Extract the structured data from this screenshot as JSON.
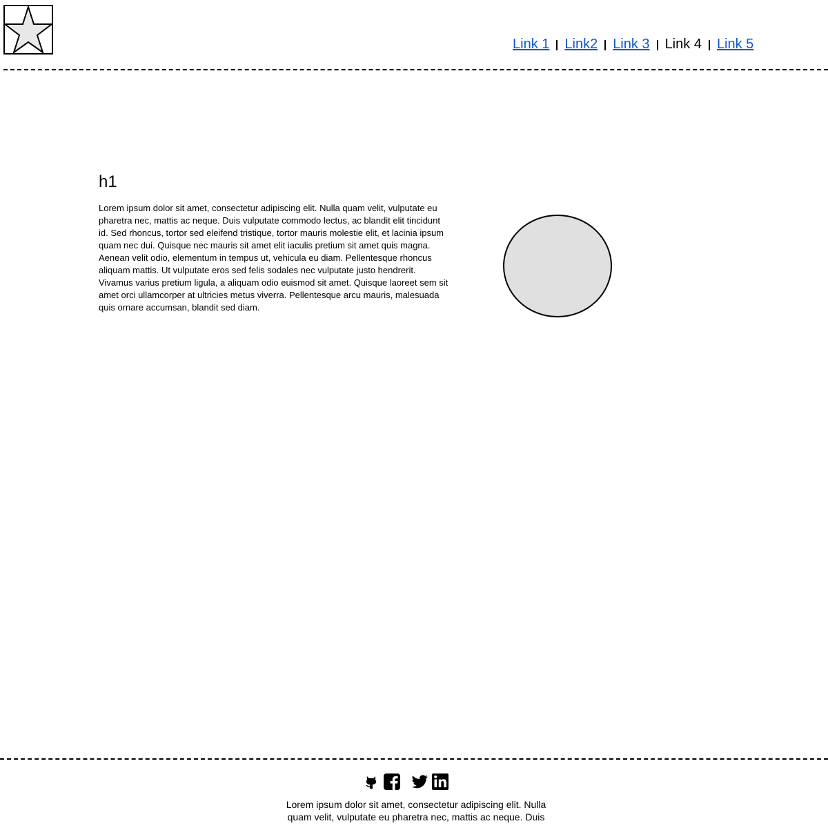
{
  "header": {
    "logo_icon": "star-icon",
    "nav": [
      {
        "label": "Link 1",
        "is_link": true
      },
      {
        "label": "Link2",
        "is_link": true
      },
      {
        "label": "Link 3",
        "is_link": true
      },
      {
        "label": "Link 4",
        "is_link": false
      },
      {
        "label": "Link 5",
        "is_link": true
      }
    ]
  },
  "main": {
    "title": "h1",
    "body": "Lorem ipsum dolor sit amet, consectetur adipiscing elit. Nulla quam velit, vulputate eu pharetra nec, mattis ac neque. Duis vulputate commodo lectus, ac blandit elit tincidunt id. Sed rhoncus, tortor sed eleifend tristique, tortor mauris molestie elit, et lacinia ipsum quam nec dui. Quisque nec mauris sit amet elit iaculis pretium sit amet quis magna. Aenean velit odio, elementum in tempus ut, vehicula eu diam. Pellentesque rhoncus aliquam mattis. Ut vulputate eros sed felis sodales nec vulputate justo hendrerit. Vivamus varius pretium ligula, a aliquam odio euismod sit amet. Quisque laoreet sem sit amet orci ullamcorper at ultricies metus viverra. Pellentesque arcu mauris, malesuada quis ornare accumsan, blandit sed diam.",
    "image_placeholder": "circle-image-placeholder"
  },
  "footer": {
    "social_icons": [
      "github-icon",
      "facebook-icon",
      "twitter-icon",
      "linkedin-icon"
    ],
    "text": "Lorem ipsum dolor sit amet, consectetur adipiscing elit. Nulla quam velit, vulputate eu pharetra nec, mattis ac neque. Duis"
  },
  "colors": {
    "link": "#1155cc",
    "placeholder_fill": "#e0e0e0",
    "border": "#000000"
  }
}
